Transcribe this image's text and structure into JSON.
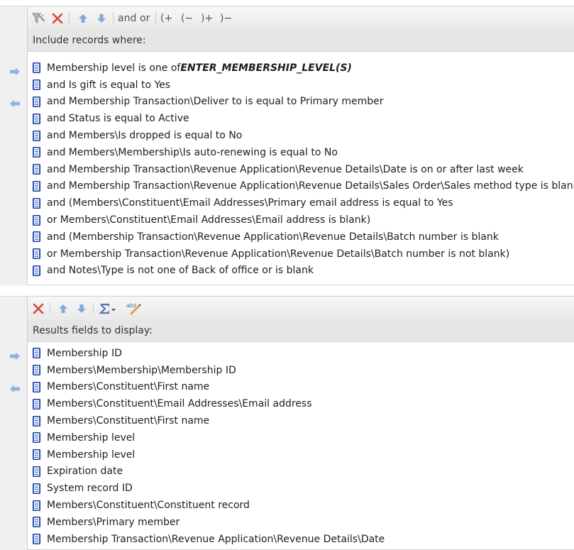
{
  "filter_panel": {
    "toolbar": {
      "and_label": "and",
      "or_label": "or",
      "open_paren_add_label": "(+",
      "open_paren_remove_label": "(−",
      "close_paren_add_label": ")+",
      "close_paren_remove_label": ")−"
    },
    "header": "Include records where:",
    "rows": [
      {
        "text": "Membership level is one of ",
        "param": "ENTER_MEMBERSHIP_LEVEL(S)"
      },
      {
        "text": "and Is gift is equal to Yes"
      },
      {
        "text": "and Membership Transaction\\Deliver to is equal to Primary member"
      },
      {
        "text": "and Status is equal to Active"
      },
      {
        "text": "and Members\\Is dropped is equal to No"
      },
      {
        "text": "and Members\\Membership\\Is auto-renewing is equal to No"
      },
      {
        "text": "and Membership Transaction\\Revenue Application\\Revenue Details\\Date is on or after last week"
      },
      {
        "text": "and Membership Transaction\\Revenue Application\\Revenue Details\\Sales Order\\Sales method type is blank"
      },
      {
        "text": "and (Members\\Constituent\\Email Addresses\\Primary email address is equal to Yes"
      },
      {
        "text": "or Members\\Constituent\\Email Addresses\\Email address is blank)"
      },
      {
        "text": "and (Membership Transaction\\Revenue Application\\Revenue Details\\Batch number is blank"
      },
      {
        "text": "or Membership Transaction\\Revenue Application\\Revenue Details\\Batch number is not blank)"
      },
      {
        "text": "and Notes\\Type is not one of Back of office or is blank"
      }
    ]
  },
  "results_panel": {
    "header": "Results fields to display:",
    "rows": [
      "Membership ID",
      "Members\\Membership\\Membership ID",
      "Members\\Constituent\\First name",
      "Members\\Constituent\\Email Addresses\\Email address",
      "Members\\Constituent\\First name",
      "Membership level",
      "Membership level",
      "Expiration date",
      "System record ID",
      "Members\\Constituent\\Constituent record",
      "Members\\Primary member",
      "Membership Transaction\\Revenue Application\\Revenue Details\\Date"
    ]
  },
  "colors": {
    "arrow": "#8fb4e3",
    "delete": "#d9443a",
    "doc_icon": "#2f55b8"
  }
}
